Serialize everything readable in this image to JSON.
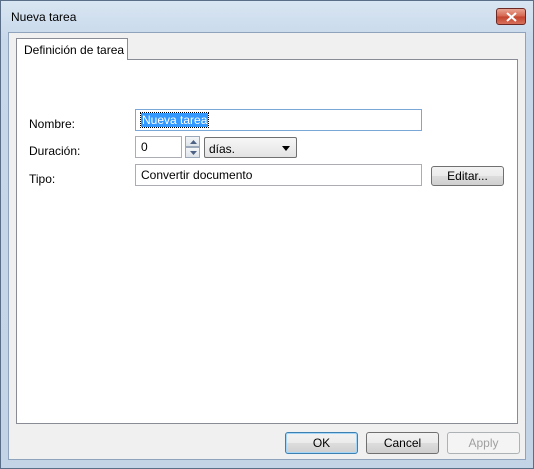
{
  "window": {
    "title": "Nueva tarea"
  },
  "tabs": [
    {
      "label": "Definición de tarea"
    }
  ],
  "form": {
    "name_label": "Nombre:",
    "name_value": "Nueva tarea",
    "duration_label": "Duración:",
    "duration_value": "0",
    "duration_unit": "días.",
    "type_label": "Tipo:",
    "type_value": "Convertir documento",
    "edit_button": "Editar..."
  },
  "footer": {
    "ok_label": "OK",
    "cancel_label": "Cancel",
    "apply_label": "Apply"
  }
}
